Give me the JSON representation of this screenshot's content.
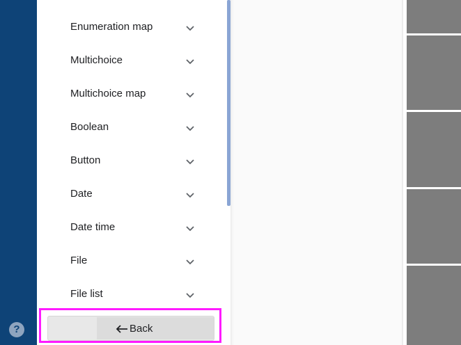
{
  "help": {
    "glyph": "?"
  },
  "panel": {
    "items": [
      {
        "label": "Enumeration map"
      },
      {
        "label": "Multichoice"
      },
      {
        "label": "Multichoice map"
      },
      {
        "label": "Boolean"
      },
      {
        "label": "Button"
      },
      {
        "label": "Date"
      },
      {
        "label": "Date time"
      },
      {
        "label": "File"
      },
      {
        "label": "File list"
      }
    ]
  },
  "back_button": {
    "label": "Back"
  },
  "colors": {
    "rail": "#0e4377",
    "highlight": "#ff1aff",
    "scroll_thumb": "#8aa5d4",
    "gray_blocks": "#7d7d7d"
  }
}
